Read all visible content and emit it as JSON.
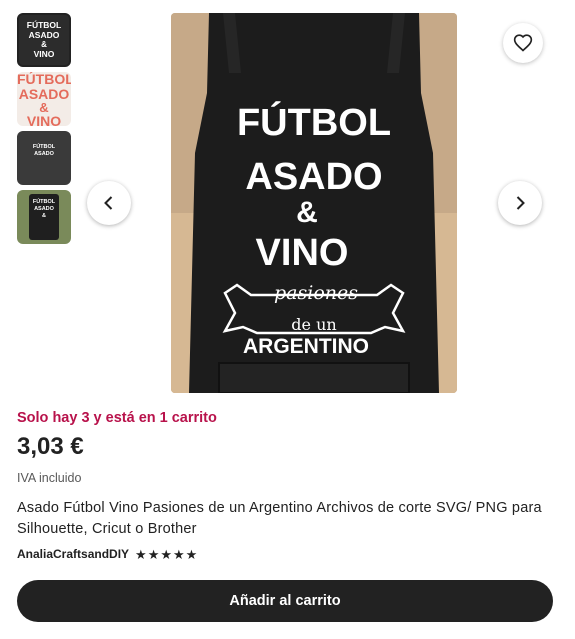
{
  "gallery": {
    "thumbnails": [
      {
        "lines": [
          "FÚTBOL",
          "ASADO",
          "&",
          "VINO"
        ]
      },
      {
        "lines": [
          "FÚTBOL",
          "ASADO",
          "&",
          "VINO"
        ]
      },
      {
        "lines": [
          "FÚTBOL",
          "ASADO"
        ]
      },
      {
        "lines": [
          "FÚTBOL",
          "ASADO",
          "&"
        ]
      }
    ],
    "main_image": {
      "line1": "FÚTBOL",
      "line2": "ASADO",
      "line3": "&",
      "line4": "VINO",
      "banner": "pasiones",
      "line5": "de un",
      "line6": "ARGENTINO"
    },
    "prev_icon": "chevron-left-icon",
    "next_icon": "chevron-right-icon",
    "favorite_icon": "heart-icon"
  },
  "listing": {
    "stock_message": "Solo hay 3 y está en 1 carrito",
    "price": "3,03 €",
    "tax_note": "IVA incluido",
    "title": "Asado Fútbol Vino Pasiones de un Argentino Archivos de corte SVG/ PNG para Silhouette, Cricut o Brother",
    "shop_name": "AnaliaCraftsandDIY",
    "rating_stars": 5,
    "add_to_cart_label": "Añadir al carrito"
  },
  "colors": {
    "stock_message": "#b8124b",
    "button_bg": "#222222",
    "apron": "#1c1c1c"
  }
}
